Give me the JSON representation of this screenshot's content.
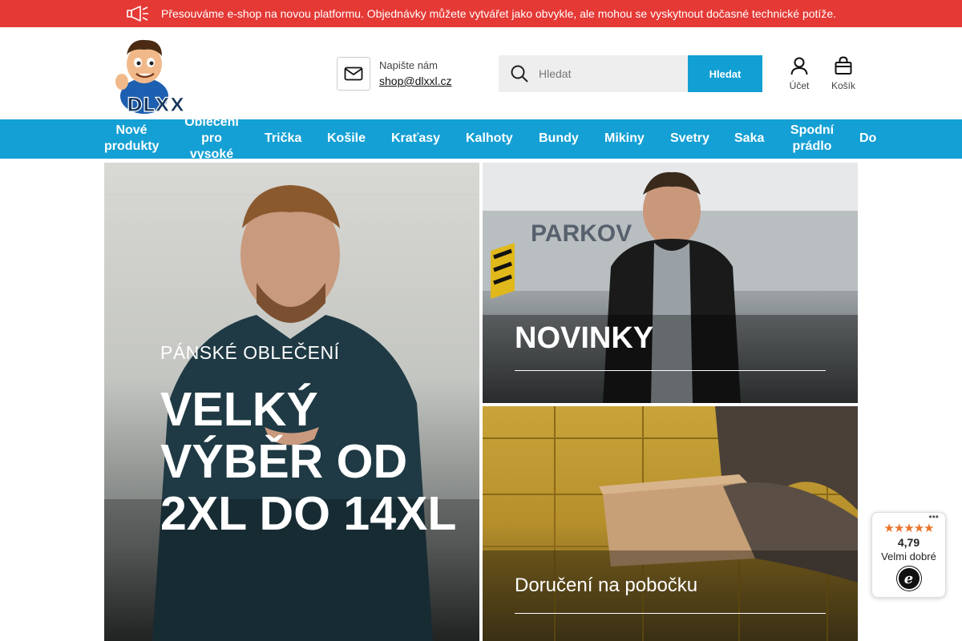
{
  "announcement": {
    "text": "Přesouváme e-shop na novou platformu. Objednávky můžete vytvářet jako obvykle, ale mohou se vyskytnout dočasné technické potíže.",
    "icon": "megaphone-icon",
    "bg": "#e53935"
  },
  "header": {
    "logo_text": "DLXXL",
    "contact": {
      "label": "Napište nám",
      "email": "shop@dlxxl.cz",
      "icon": "mail-icon"
    },
    "search": {
      "placeholder": "Hledat",
      "button_label": "Hledat",
      "icon": "search-icon"
    },
    "account_label": "Účet",
    "cart_label": "Košík"
  },
  "nav": {
    "bg": "#14a0d4",
    "items": [
      {
        "label": "Nové\nprodukty"
      },
      {
        "label": "Oblečení\npro\nvysoké"
      },
      {
        "label": "Trička"
      },
      {
        "label": "Košile"
      },
      {
        "label": "Kraťasy"
      },
      {
        "label": "Kalhoty"
      },
      {
        "label": "Bundy"
      },
      {
        "label": "Mikiny"
      },
      {
        "label": "Svetry"
      },
      {
        "label": "Saka"
      },
      {
        "label": "Spodní\nprádlo"
      },
      {
        "label": "Do"
      }
    ]
  },
  "banners": {
    "main": {
      "subtitle": "PÁNSKÉ OBLEČENÍ",
      "title": "VELKÝ VÝBĚR OD 2XL DO 14XL"
    },
    "new": {
      "title": "NOVINKY"
    },
    "delivery": {
      "title": "Doručení na pobočku"
    }
  },
  "rating": {
    "stars": "★★★★★",
    "score": "4,79",
    "verdict": "Velmi dobré",
    "badge": "e",
    "star_color": "#e8742b"
  }
}
